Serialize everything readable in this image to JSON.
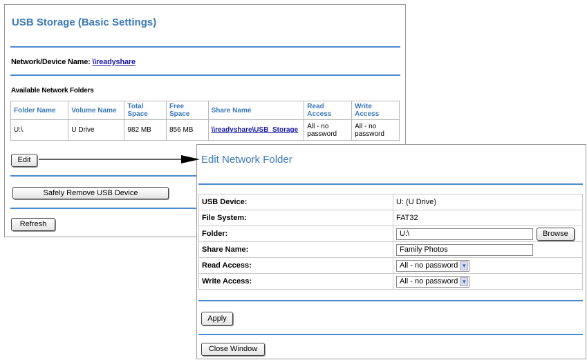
{
  "main_panel": {
    "title": "USB Storage (Basic Settings)",
    "device_name_label": "Network/Device Name:",
    "device_name_value": "\\\\readyshare",
    "folders_heading": "Available Network Folders",
    "table": {
      "headers": [
        "Folder Name",
        "Volume Name",
        "Total Space",
        "Free Space",
        "Share Name",
        "Read Access",
        "Write Access"
      ],
      "rows": [
        {
          "folder": "U:\\",
          "volume": "U Drive",
          "total": "982 MB",
          "free": "856 MB",
          "share": "\\\\readyshare\\USB_Storage",
          "read": "All - no password",
          "write": "All - no password"
        }
      ]
    },
    "edit_label": "Edit",
    "safely_remove_label": "Safely Remove USB Device",
    "refresh_label": "Refresh"
  },
  "edit_panel": {
    "title": "Edit Network Folder",
    "usb_device_label": "USB Device:",
    "usb_device_value": "U: (U Drive)",
    "file_system_label": "File System:",
    "file_system_value": "FAT32",
    "folder_label": "Folder:",
    "folder_value": "U:\\",
    "browse_label": "Browse",
    "share_name_label": "Share Name:",
    "share_name_value": "Family Photos",
    "read_access_label": "Read Access:",
    "read_access_value": "All - no password",
    "write_access_label": "Write Access:",
    "write_access_value": "All - no password",
    "apply_label": "Apply",
    "close_label": "Close Window"
  },
  "colors": {
    "title": "#3a78b8",
    "rule": "#4a8ad0",
    "link": "#1a1aa6"
  }
}
